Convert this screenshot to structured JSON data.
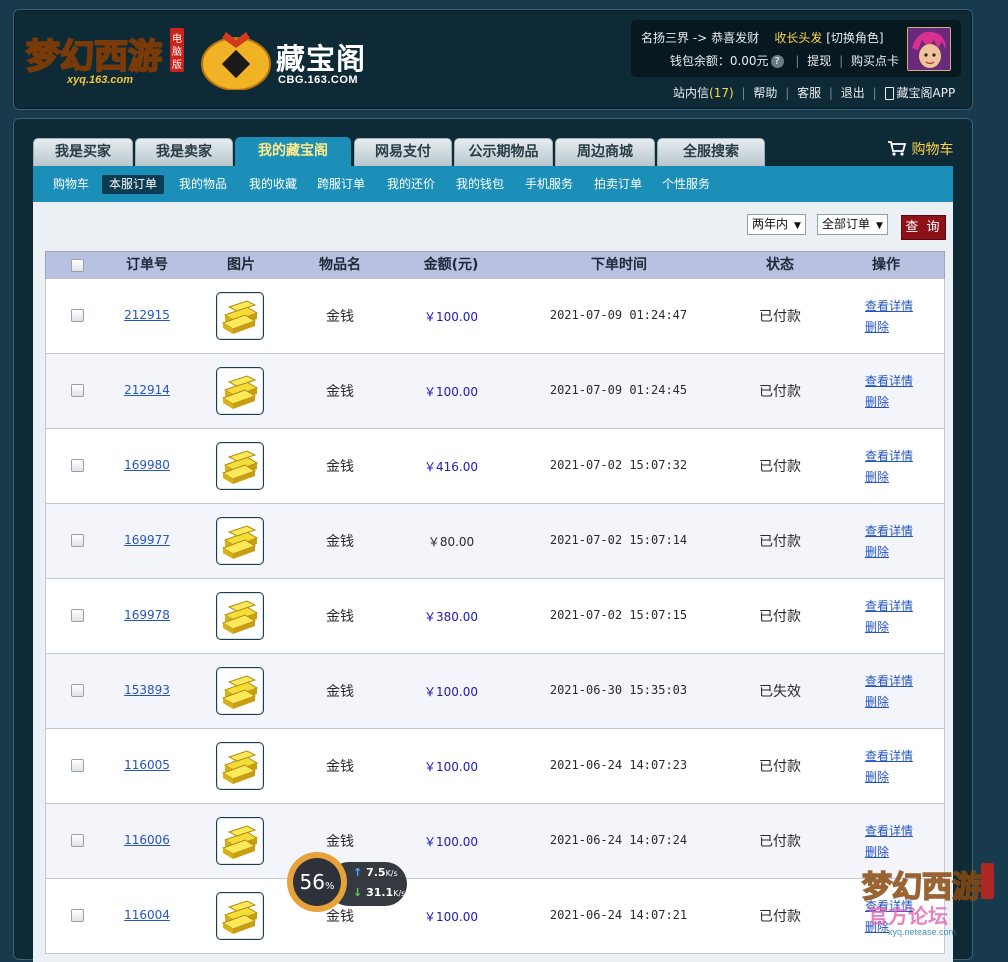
{
  "header": {
    "logo_mhxy_text": "梦幻西游",
    "logo_mhxy_badge": "电脑版",
    "logo_mhxy_domain": "xyq.163.com",
    "logo_cbg_text": "藏宝阁",
    "logo_cbg_domain": "CBG.163.COM",
    "user": {
      "server": "名扬三界",
      "arrow": "->",
      "role": "恭喜发财",
      "title": "收长头发",
      "switch_role": "[切换角色]",
      "wallet_label": "钱包余额：",
      "wallet_value": "0.00元",
      "help_icon": "?",
      "withdraw": "提现",
      "buy_card": "购买点卡"
    },
    "links": {
      "inbox": "站内信",
      "inbox_count": "(17)",
      "help": "帮助",
      "service": "客服",
      "logout": "退出",
      "app": "藏宝阁APP"
    }
  },
  "tabs": [
    "我是买家",
    "我是卖家",
    "我的藏宝阁",
    "网易支付",
    "公示期物品",
    "周边商城",
    "全服搜索"
  ],
  "active_tab": "我的藏宝阁",
  "cart_label": "购物车",
  "subnav": [
    "购物车",
    "本服订单",
    "我的物品",
    "我的收藏",
    "跨服订单",
    "我的还价",
    "我的钱包",
    "手机服务",
    "拍卖订单",
    "个性服务"
  ],
  "active_subnav": "本服订单",
  "filters": {
    "range": "两年内",
    "type": "全部订单",
    "query": "查 询"
  },
  "table": {
    "headers": [
      "订单号",
      "图片",
      "物品名",
      "金额(元)",
      "下单时间",
      "状态",
      "操作"
    ],
    "rows": [
      {
        "id": "212915",
        "item": "金钱",
        "amount": "￥100.00",
        "amount_color": "#1a1ab8",
        "time": "2021-07-09 01:24:47",
        "status": "已付款"
      },
      {
        "id": "212914",
        "item": "金钱",
        "amount": "￥100.00",
        "amount_color": "#1a1ab8",
        "time": "2021-07-09 01:24:45",
        "status": "已付款"
      },
      {
        "id": "169980",
        "item": "金钱",
        "amount": "￥416.00",
        "amount_color": "#1a1ab8",
        "time": "2021-07-02 15:07:32",
        "status": "已付款"
      },
      {
        "id": "169977",
        "item": "金钱",
        "amount": "￥80.00",
        "amount_color": "#2a2a2a",
        "time": "2021-07-02 15:07:14",
        "status": "已付款"
      },
      {
        "id": "169978",
        "item": "金钱",
        "amount": "￥380.00",
        "amount_color": "#1a1ab8",
        "time": "2021-07-02 15:07:15",
        "status": "已付款"
      },
      {
        "id": "153893",
        "item": "金钱",
        "amount": "￥100.00",
        "amount_color": "#1a1ab8",
        "time": "2021-06-30 15:35:03",
        "status": "已失效"
      },
      {
        "id": "116005",
        "item": "金钱",
        "amount": "￥100.00",
        "amount_color": "#1a1ab8",
        "time": "2021-06-24 14:07:23",
        "status": "已付款"
      },
      {
        "id": "116006",
        "item": "金钱",
        "amount": "￥100.00",
        "amount_color": "#1a1ab8",
        "time": "2021-06-24 14:07:24",
        "status": "已付款"
      },
      {
        "id": "116004",
        "item": "金钱",
        "amount": "￥100.00",
        "amount_color": "#1a1ab8",
        "time": "2021-06-24 14:07:21",
        "status": "已付款"
      }
    ],
    "action_view": "查看详情",
    "action_delete": "删除"
  },
  "speed_widget": {
    "percent": "56",
    "percent_unit": "%",
    "upload": "7.5",
    "upload_unit": "K/s",
    "download": "31.1",
    "download_unit": "K/s"
  },
  "watermark": {
    "text": "梦幻西游",
    "badge": "电脑版",
    "sub": "官方论坛",
    "domain": "xyq.netease.com"
  }
}
